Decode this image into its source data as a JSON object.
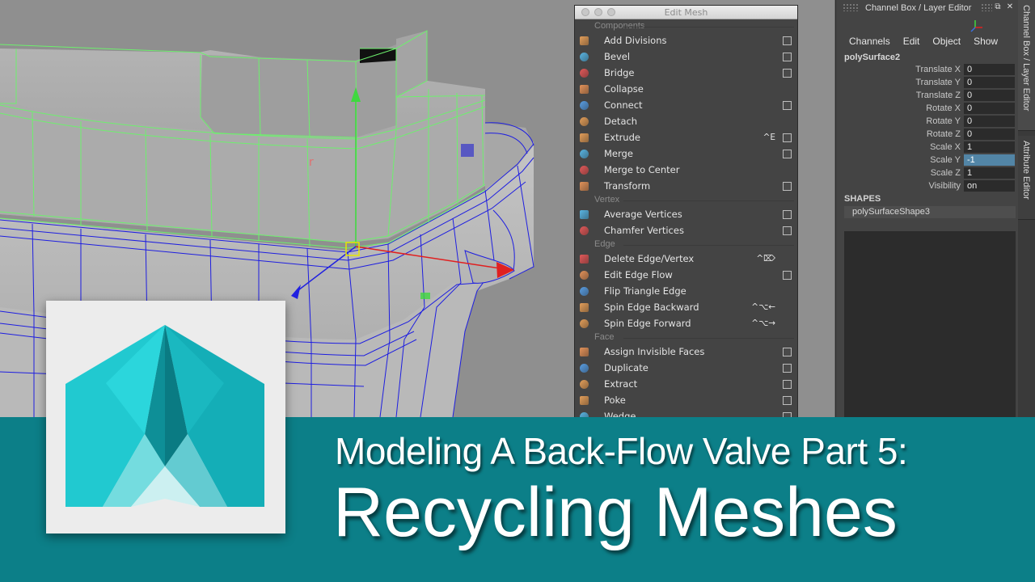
{
  "edit_mesh": {
    "title": "Edit Mesh",
    "sections": [
      {
        "label": "Components",
        "items": [
          {
            "label": "Add Divisions",
            "shortcut": "",
            "has_option_box": true,
            "icon": "add-divisions-icon"
          },
          {
            "label": "Bevel",
            "shortcut": "",
            "has_option_box": true,
            "icon": "bevel-icon"
          },
          {
            "label": "Bridge",
            "shortcut": "",
            "has_option_box": true,
            "icon": "bridge-icon"
          },
          {
            "label": "Collapse",
            "shortcut": "",
            "has_option_box": false,
            "icon": "collapse-icon"
          },
          {
            "label": "Connect",
            "shortcut": "",
            "has_option_box": true,
            "icon": "connect-icon"
          },
          {
            "label": "Detach",
            "shortcut": "",
            "has_option_box": false,
            "icon": "detach-icon"
          },
          {
            "label": "Extrude",
            "shortcut": "^E",
            "has_option_box": true,
            "icon": "extrude-icon"
          },
          {
            "label": "Merge",
            "shortcut": "",
            "has_option_box": true,
            "icon": "merge-icon"
          },
          {
            "label": "Merge to Center",
            "shortcut": "",
            "has_option_box": false,
            "icon": "merge-to-center-icon"
          },
          {
            "label": "Transform",
            "shortcut": "",
            "has_option_box": true,
            "icon": "transform-icon"
          }
        ]
      },
      {
        "label": "Vertex",
        "items": [
          {
            "label": "Average Vertices",
            "shortcut": "",
            "has_option_box": true,
            "icon": "average-vertices-icon"
          },
          {
            "label": "Chamfer Vertices",
            "shortcut": "",
            "has_option_box": true,
            "icon": "chamfer-vertices-icon"
          }
        ]
      },
      {
        "label": "Edge",
        "items": [
          {
            "label": "Delete Edge/Vertex",
            "shortcut": "^⌦",
            "has_option_box": false,
            "icon": "delete-edge-vertex-icon"
          },
          {
            "label": "Edit Edge Flow",
            "shortcut": "",
            "has_option_box": true,
            "icon": "edit-edge-flow-icon"
          },
          {
            "label": "Flip Triangle Edge",
            "shortcut": "",
            "has_option_box": false,
            "icon": "flip-triangle-edge-icon"
          },
          {
            "label": "Spin Edge Backward",
            "shortcut": "^⌥←",
            "has_option_box": false,
            "icon": "spin-edge-backward-icon"
          },
          {
            "label": "Spin Edge Forward",
            "shortcut": "^⌥→",
            "has_option_box": false,
            "icon": "spin-edge-forward-icon"
          }
        ]
      },
      {
        "label": "Face",
        "items": [
          {
            "label": "Assign Invisible Faces",
            "shortcut": "",
            "has_option_box": true,
            "icon": "assign-invisible-faces-icon"
          },
          {
            "label": "Duplicate",
            "shortcut": "",
            "has_option_box": true,
            "icon": "duplicate-icon"
          },
          {
            "label": "Extract",
            "shortcut": "",
            "has_option_box": true,
            "icon": "extract-icon"
          },
          {
            "label": "Poke",
            "shortcut": "",
            "has_option_box": true,
            "icon": "poke-icon"
          },
          {
            "label": "Wedge",
            "shortcut": "",
            "has_option_box": true,
            "icon": "wedge-icon"
          }
        ]
      }
    ]
  },
  "channel_box": {
    "title": "Channel Box / Layer Editor",
    "menu": [
      "Channels",
      "Edit",
      "Object",
      "Show"
    ],
    "object_name": "polySurface2",
    "attributes": [
      {
        "label": "Translate X",
        "value": "0",
        "selected": false
      },
      {
        "label": "Translate Y",
        "value": "0",
        "selected": false
      },
      {
        "label": "Translate Z",
        "value": "0",
        "selected": false
      },
      {
        "label": "Rotate X",
        "value": "0",
        "selected": false
      },
      {
        "label": "Rotate Y",
        "value": "0",
        "selected": false
      },
      {
        "label": "Rotate Z",
        "value": "0",
        "selected": false
      },
      {
        "label": "Scale X",
        "value": "1",
        "selected": false
      },
      {
        "label": "Scale Y",
        "value": "-1",
        "selected": true
      },
      {
        "label": "Scale Z",
        "value": "1",
        "selected": false
      },
      {
        "label": "Visibility",
        "value": "on",
        "selected": false
      }
    ],
    "shapes_label": "SHAPES",
    "shape_name": "polySurfaceShape3"
  },
  "side_tabs": [
    "Channel Box / Layer Editor",
    "Attribute Editor"
  ],
  "banner": {
    "title": "Modeling A Back-Flow Valve Part 5:",
    "subtitle": "Recycling Meshes"
  },
  "colors": {
    "banner": "#0c7f88",
    "panel": "#444444",
    "selected_value": "#5285a6",
    "wire_green": "#6df06d",
    "wire_blue": "#1e1ee0",
    "logo_teal": "#19c4cc"
  }
}
